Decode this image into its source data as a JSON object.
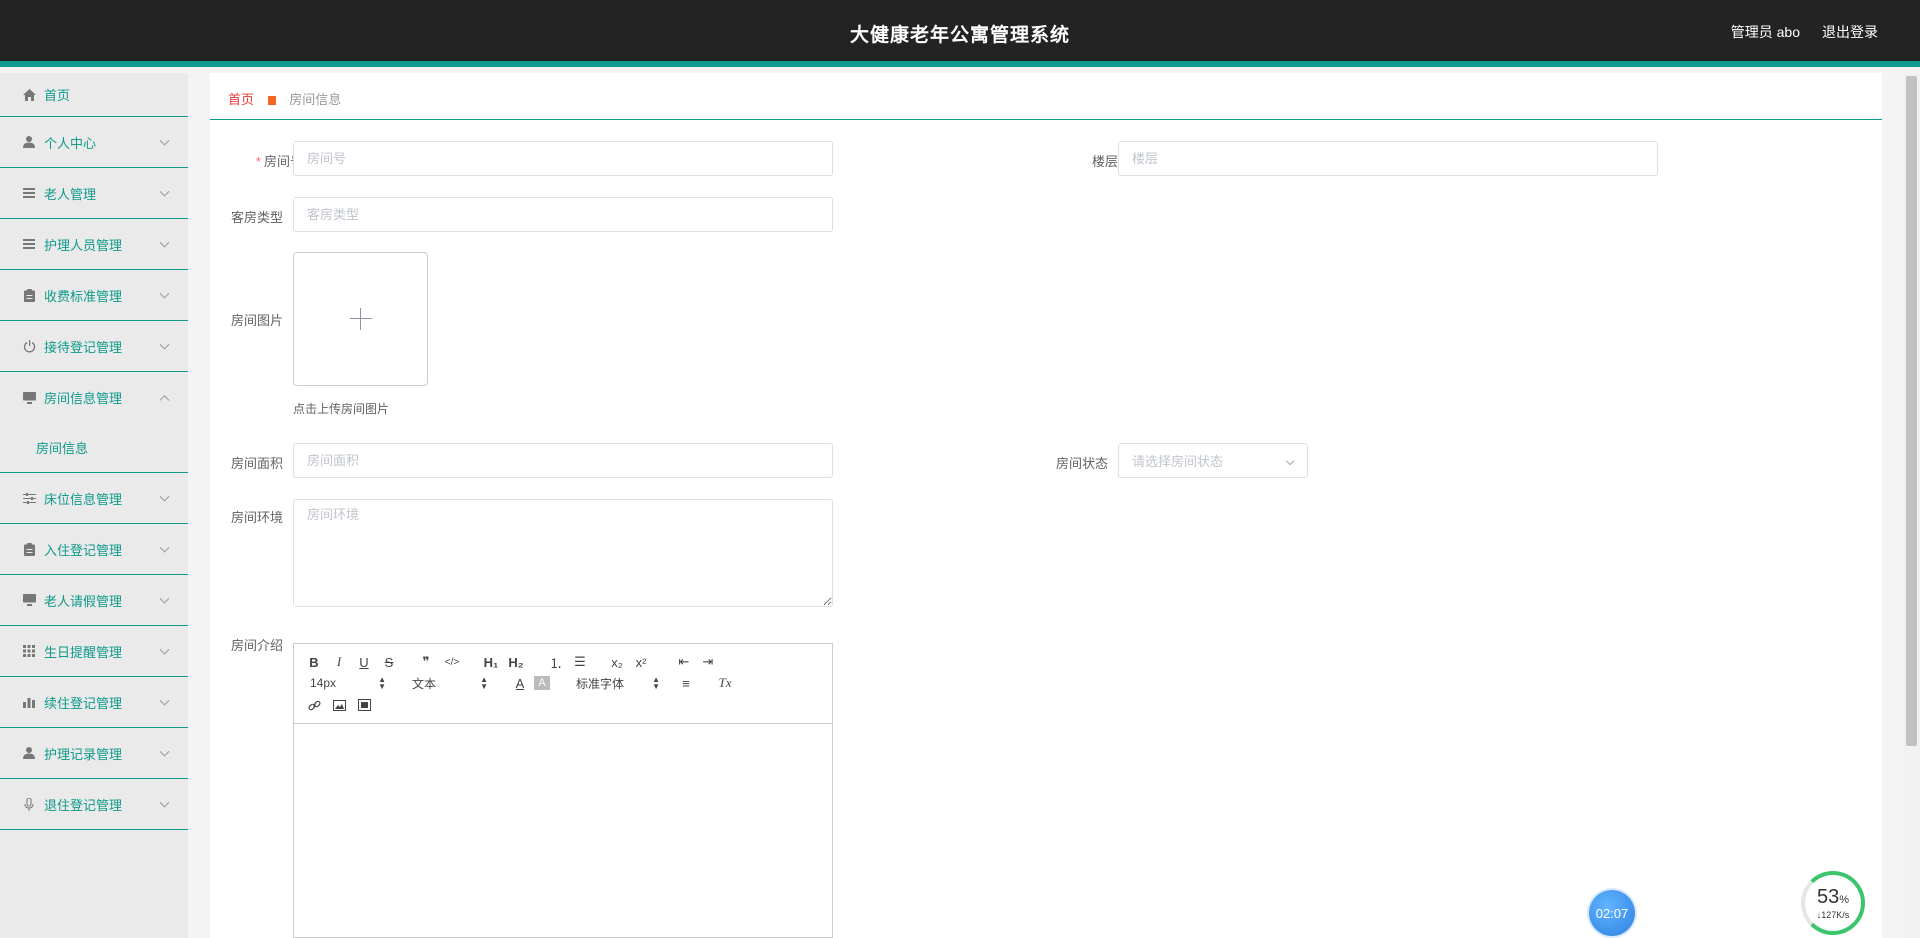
{
  "header": {
    "title": "大健康老年公寓管理系统",
    "user": "管理员 abo",
    "logout": "退出登录"
  },
  "sidebar": {
    "items": [
      {
        "label": "首页",
        "icon": "home-icon",
        "chevron": false
      },
      {
        "label": "个人中心",
        "icon": "user-icon",
        "chevron": true
      },
      {
        "label": "老人管理",
        "icon": "list-icon",
        "chevron": true
      },
      {
        "label": "护理人员管理",
        "icon": "list-icon",
        "chevron": true
      },
      {
        "label": "收费标准管理",
        "icon": "clipboard-icon",
        "chevron": true
      },
      {
        "label": "接待登记管理",
        "icon": "power-icon",
        "chevron": true
      },
      {
        "label": "房间信息管理",
        "icon": "monitor-icon",
        "chevron": true,
        "expanded": true
      },
      {
        "label": "床位信息管理",
        "icon": "sliders-icon",
        "chevron": true
      },
      {
        "label": "入住登记管理",
        "icon": "clipboard-icon",
        "chevron": true
      },
      {
        "label": "老人请假管理",
        "icon": "monitor-icon",
        "chevron": true
      },
      {
        "label": "生日提醒管理",
        "icon": "grid-icon",
        "chevron": true
      },
      {
        "label": "续住登记管理",
        "icon": "bar-chart-icon",
        "chevron": true
      },
      {
        "label": "护理记录管理",
        "icon": "user-icon",
        "chevron": true
      },
      {
        "label": "退住登记管理",
        "icon": "microphone-icon",
        "chevron": true
      }
    ],
    "submenu_room": "房间信息"
  },
  "breadcrumb": {
    "home": "首页",
    "current": "房间信息"
  },
  "form": {
    "room_no_label": "房间号",
    "room_no_placeholder": "房间号",
    "floor_label": "楼层",
    "floor_placeholder": "楼层",
    "room_type_label": "客房类型",
    "room_type_placeholder": "客房类型",
    "image_label": "房间图片",
    "image_tip": "点击上传房间图片",
    "area_label": "房间面积",
    "area_placeholder": "房间面积",
    "status_label": "房间状态",
    "status_placeholder": "请选择房间状态",
    "env_label": "房间环境",
    "env_placeholder": "房间环境",
    "intro_label": "房间介绍"
  },
  "editor": {
    "bold": "B",
    "italic": "I",
    "underline": "U",
    "strike": "S",
    "quote": "❞",
    "code": "</>",
    "h1": "H₁",
    "h2": "H₂",
    "ordered_list": "⒈",
    "bullet_list": "☰",
    "subscript": "x₂",
    "superscript": "x²",
    "outdent": "⇤",
    "indent": "⇥",
    "size": "14px",
    "text_type": "文本",
    "color": "A",
    "background": "A",
    "font": "标准字体",
    "align": "≡",
    "clean": "Tx",
    "link": "🔗",
    "image": "▣",
    "video": "▤"
  },
  "widgets": {
    "timer": "02:07",
    "net_percent": "53",
    "net_percent_unit": "%",
    "net_speed": "↓127K/s"
  }
}
